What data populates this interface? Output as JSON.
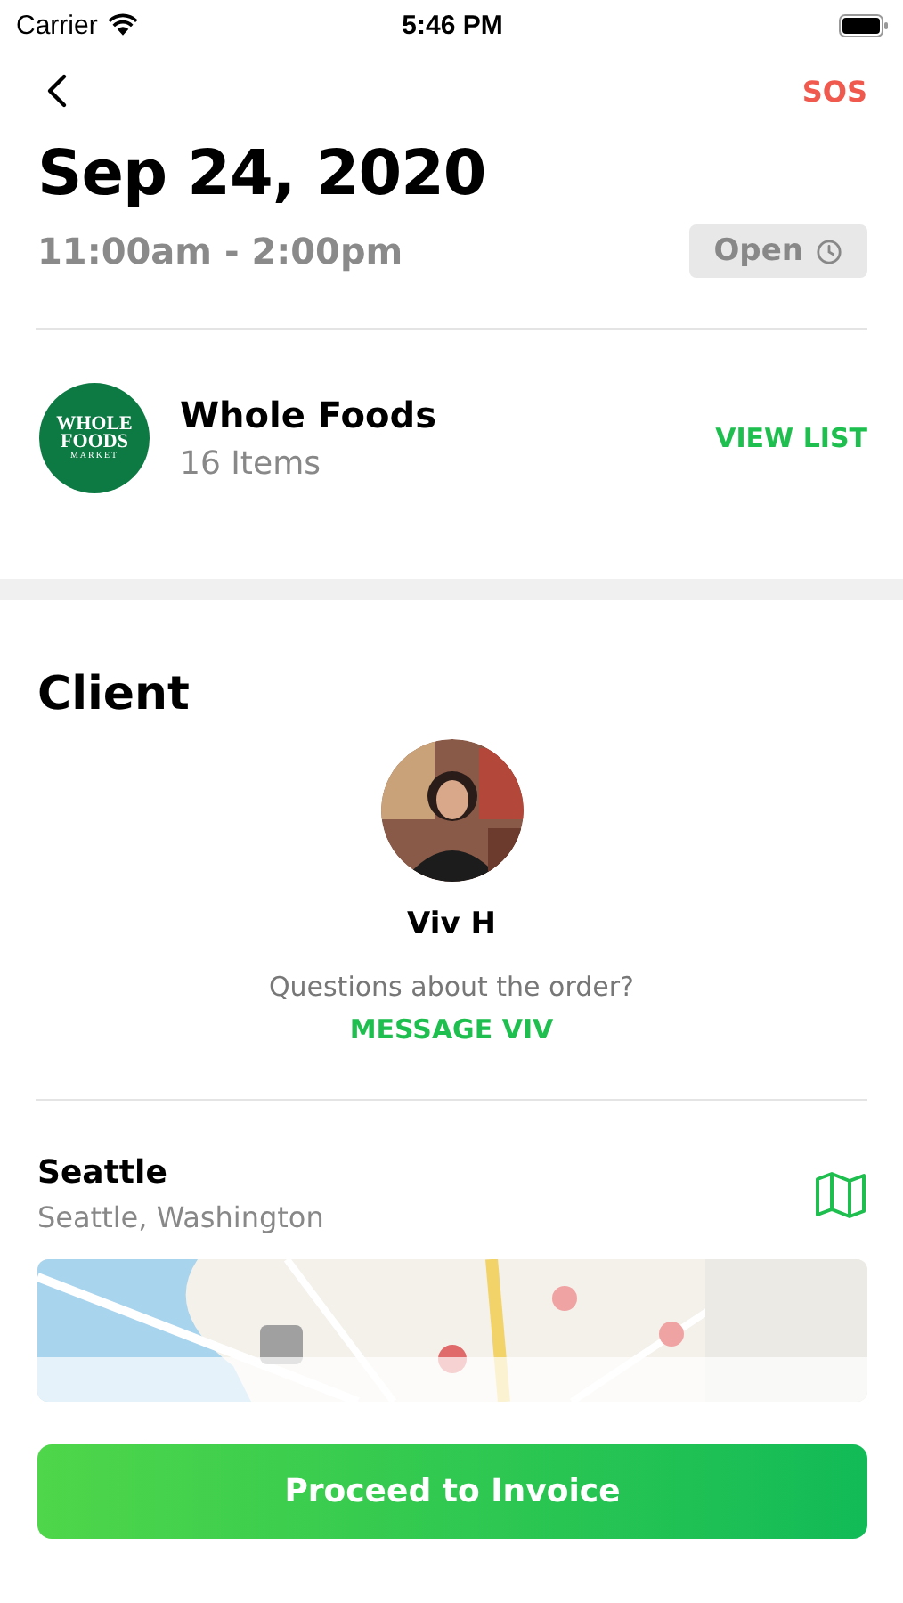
{
  "status_bar": {
    "carrier": "Carrier",
    "time": "5:46 PM"
  },
  "header": {
    "sos": "SOS"
  },
  "date": "Sep 24, 2020",
  "time_range": "11:00am - 2:00pm",
  "status": {
    "label": "Open"
  },
  "store": {
    "logo_lines": [
      "WHOLE",
      "FOODS",
      "MARKET"
    ],
    "name": "Whole Foods",
    "count": "16 Items",
    "action": "VIEW LIST"
  },
  "client": {
    "heading": "Client",
    "name": "Viv H",
    "question": "Questions about the order?",
    "action": "MESSAGE VIV"
  },
  "location": {
    "name": "Seattle",
    "region": "Seattle, Washington"
  },
  "primary_button": "Proceed to Invoice"
}
